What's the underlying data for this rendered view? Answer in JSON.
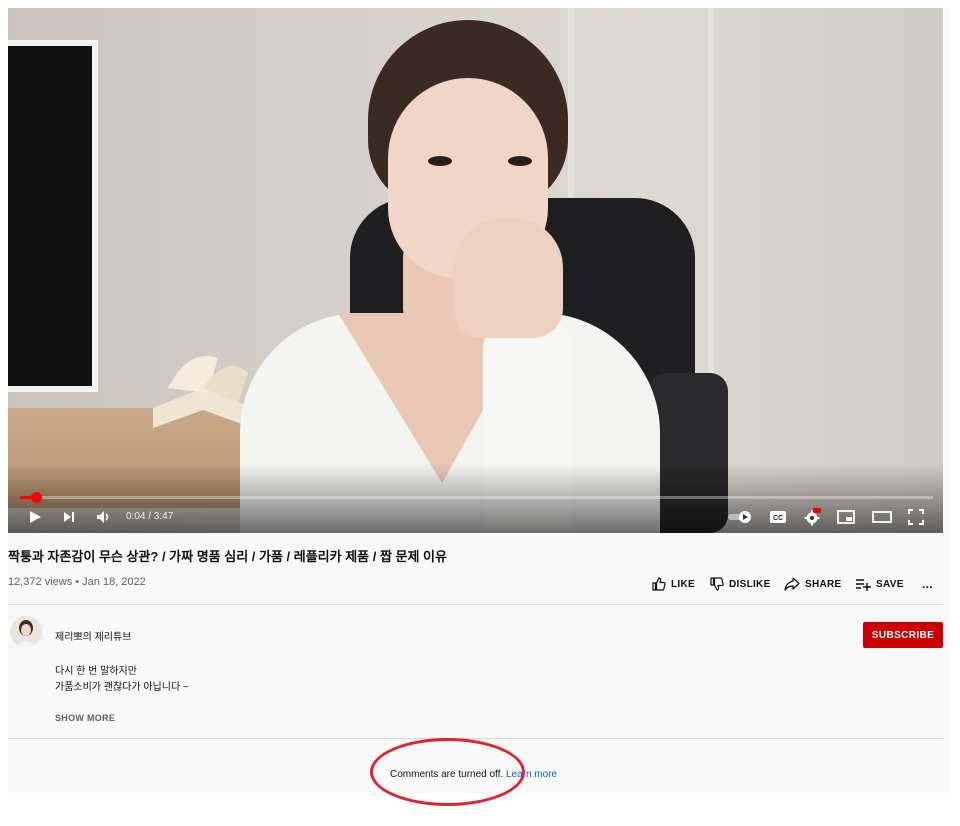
{
  "player": {
    "time_display": "0:04 / 3:47",
    "progress_fraction": 0.018,
    "accent_color": "#ff0000"
  },
  "video": {
    "title": "짝퉁과 자존감이 무슨 상관? / 가짜 명품 심리 / 가품 / 레플리카 제품 / 짭 문제 이유",
    "views_date": "12,372 views • Jan 18, 2022"
  },
  "actions": {
    "like": "LIKE",
    "dislike": "DISLIKE",
    "share": "SHARE",
    "save": "SAVE",
    "more": "..."
  },
  "channel": {
    "name": "제리뽀의 제리튜브",
    "subscribe_label": "SUBSCRIBE",
    "subscribe_color": "#cc0000"
  },
  "description": {
    "line1": "다시 한 번 말하지만",
    "line2": "가품소비가 괜찮다가 아닙니다 ~",
    "show_more": "SHOW MORE"
  },
  "comments": {
    "status": "Comments are turned off.",
    "learn_more": "Learn more",
    "link_color": "#065fd4",
    "annotation_color": "#e0242b"
  }
}
